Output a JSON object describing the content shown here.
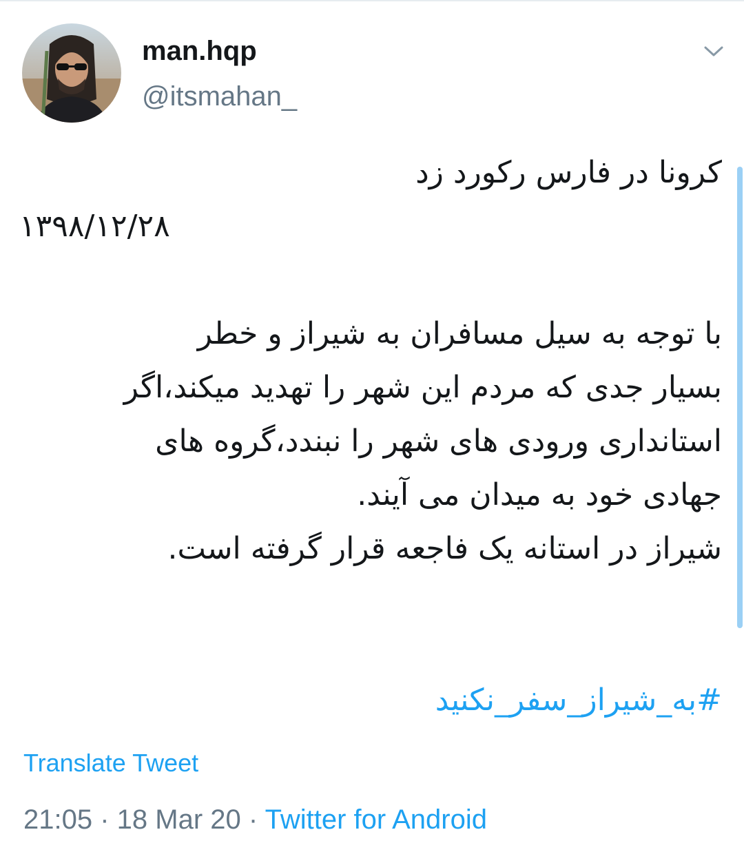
{
  "user": {
    "display_name": "man.hqp",
    "handle": "@itsmahan_"
  },
  "tweet": {
    "lines": [
      "کرونا در فارس رکورد زد",
      "۱۳۹۸/۱۲/۲۸",
      "",
      "با توجه به سیل مسافران به شیراز و خطر",
      "بسیار جدی که مردم این شهر را تهدید میکند،اگر",
      "استانداری ورودی های شهر را نبندد،گروه های",
      "جهادی خود به میدان می آیند.",
      "شیراز در استانه یک فاجعه قرار گرفته است."
    ],
    "hashtag": "#به_شیراز_سفر_نکنید",
    "translate_label": "Translate Tweet",
    "time": "21:05",
    "separator": " · ",
    "date": "18 Mar 20",
    "source": "Twitter for Android"
  },
  "icons": {
    "caret": "chevron-down-icon"
  },
  "colors": {
    "link": "#1da1f2",
    "secondary_text": "#657786",
    "primary_text": "#14171a",
    "scrollbar": "#9bd0f5"
  }
}
